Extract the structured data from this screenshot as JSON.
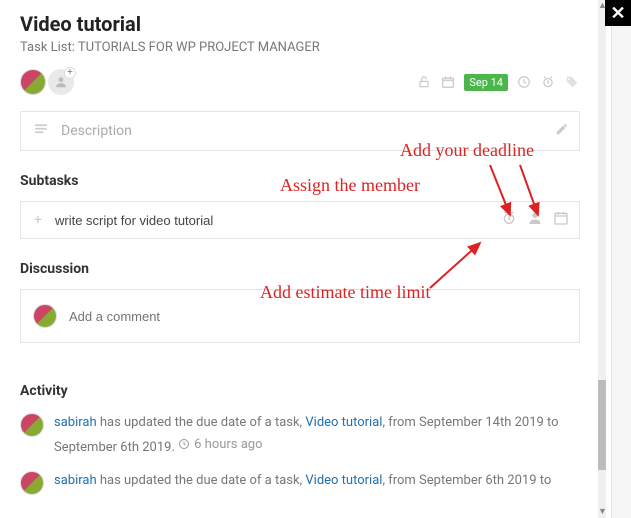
{
  "header": {
    "title": "Video tutorial",
    "task_list_prefix": "Task List: ",
    "task_list_name": "TUTORIALS FOR WP PROJECT MANAGER"
  },
  "meta": {
    "date_badge": "Sep 14"
  },
  "description": {
    "placeholder": "Description"
  },
  "subtasks": {
    "heading": "Subtasks",
    "input_value": "write script for video tutorial"
  },
  "discussion": {
    "heading": "Discussion",
    "placeholder": "Add a comment"
  },
  "activity": {
    "heading": "Activity",
    "items": [
      {
        "user": "sabirah",
        "text_mid": " has updated the due date of a task, ",
        "task": "Video tutorial",
        "text_end": ", from September 14th 2019 to September 6th 2019.",
        "time": "6 hours ago"
      },
      {
        "user": "sabirah",
        "text_mid": " has updated the due date of a task, ",
        "task": "Video tutorial",
        "text_end": ", from September 6th 2019 to",
        "time": ""
      }
    ]
  },
  "annotations": {
    "deadline": "Add your deadline",
    "member": "Assign the member",
    "estimate": "Add estimate time limit"
  }
}
